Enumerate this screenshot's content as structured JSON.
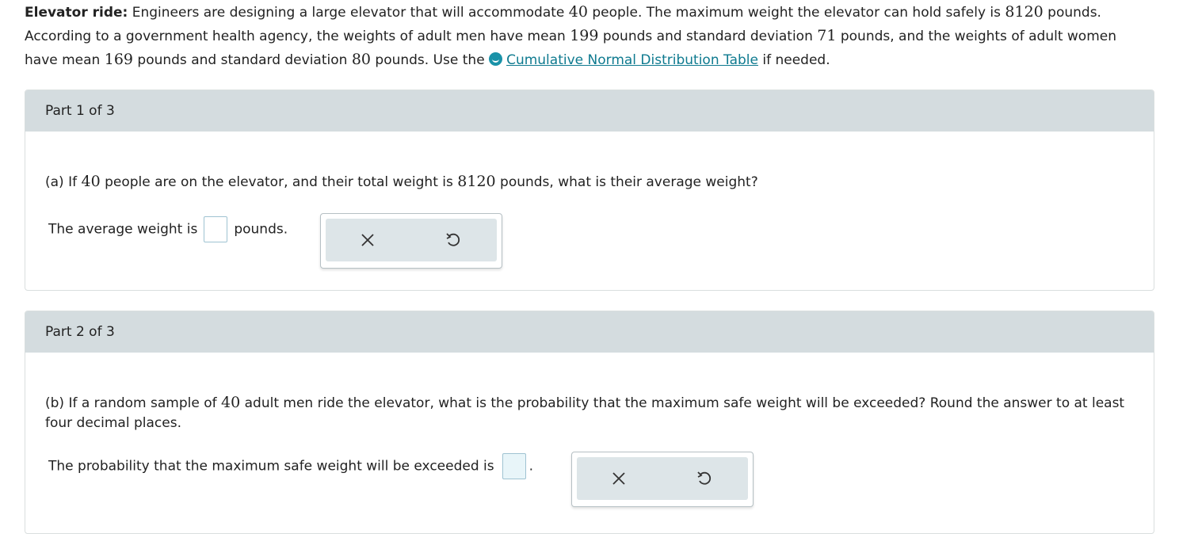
{
  "problem": {
    "title": "Elevator ride:",
    "line1_a": " Engineers are designing a large elevator that will accommodate ",
    "n_people": "40",
    "line1_b": " people. The maximum weight the elevator can hold safely is ",
    "max_weight": "8120",
    "line1_c": " pounds.",
    "line2_a": "According to a government health agency, the weights of adult men have mean ",
    "men_mean": "199",
    "line2_b": " pounds and standard deviation ",
    "men_sd": "71",
    "line2_c": " pounds, and the weights of adult women",
    "line3_a": "have mean ",
    "women_mean": "169",
    "line3_b": " pounds and standard deviation ",
    "women_sd": "80",
    "line3_c": " pounds. Use the ",
    "link_text": "Cumulative Normal Distribution Table",
    "line3_d": " if needed."
  },
  "part1": {
    "header": "Part 1 of 3",
    "q_a": "(a) If ",
    "q_n": "40",
    "q_b": " people are on the elevator, and their total weight is ",
    "q_w": "8120",
    "q_c": " pounds, what is their average weight?",
    "answer_prefix": "The average weight is",
    "answer_suffix": "pounds.",
    "answer_value": ""
  },
  "part2": {
    "header": "Part 2 of 3",
    "q_a": "(b) If a random sample of ",
    "q_n": "40",
    "q_b": " adult men ride the elevator, what is the probability that the maximum safe weight will be exceeded? Round the answer to at least four decimal places.",
    "answer_prefix": "The probability that the maximum safe weight will be exceeded is",
    "answer_suffix": ".",
    "answer_value": ""
  },
  "icons": {
    "clear": "close-icon",
    "reset": "undo-icon",
    "link": "book-icon"
  },
  "colors": {
    "header_bg": "#d4dcdf",
    "link": "#0e7a8f",
    "input_border": "#9fc3d2"
  }
}
